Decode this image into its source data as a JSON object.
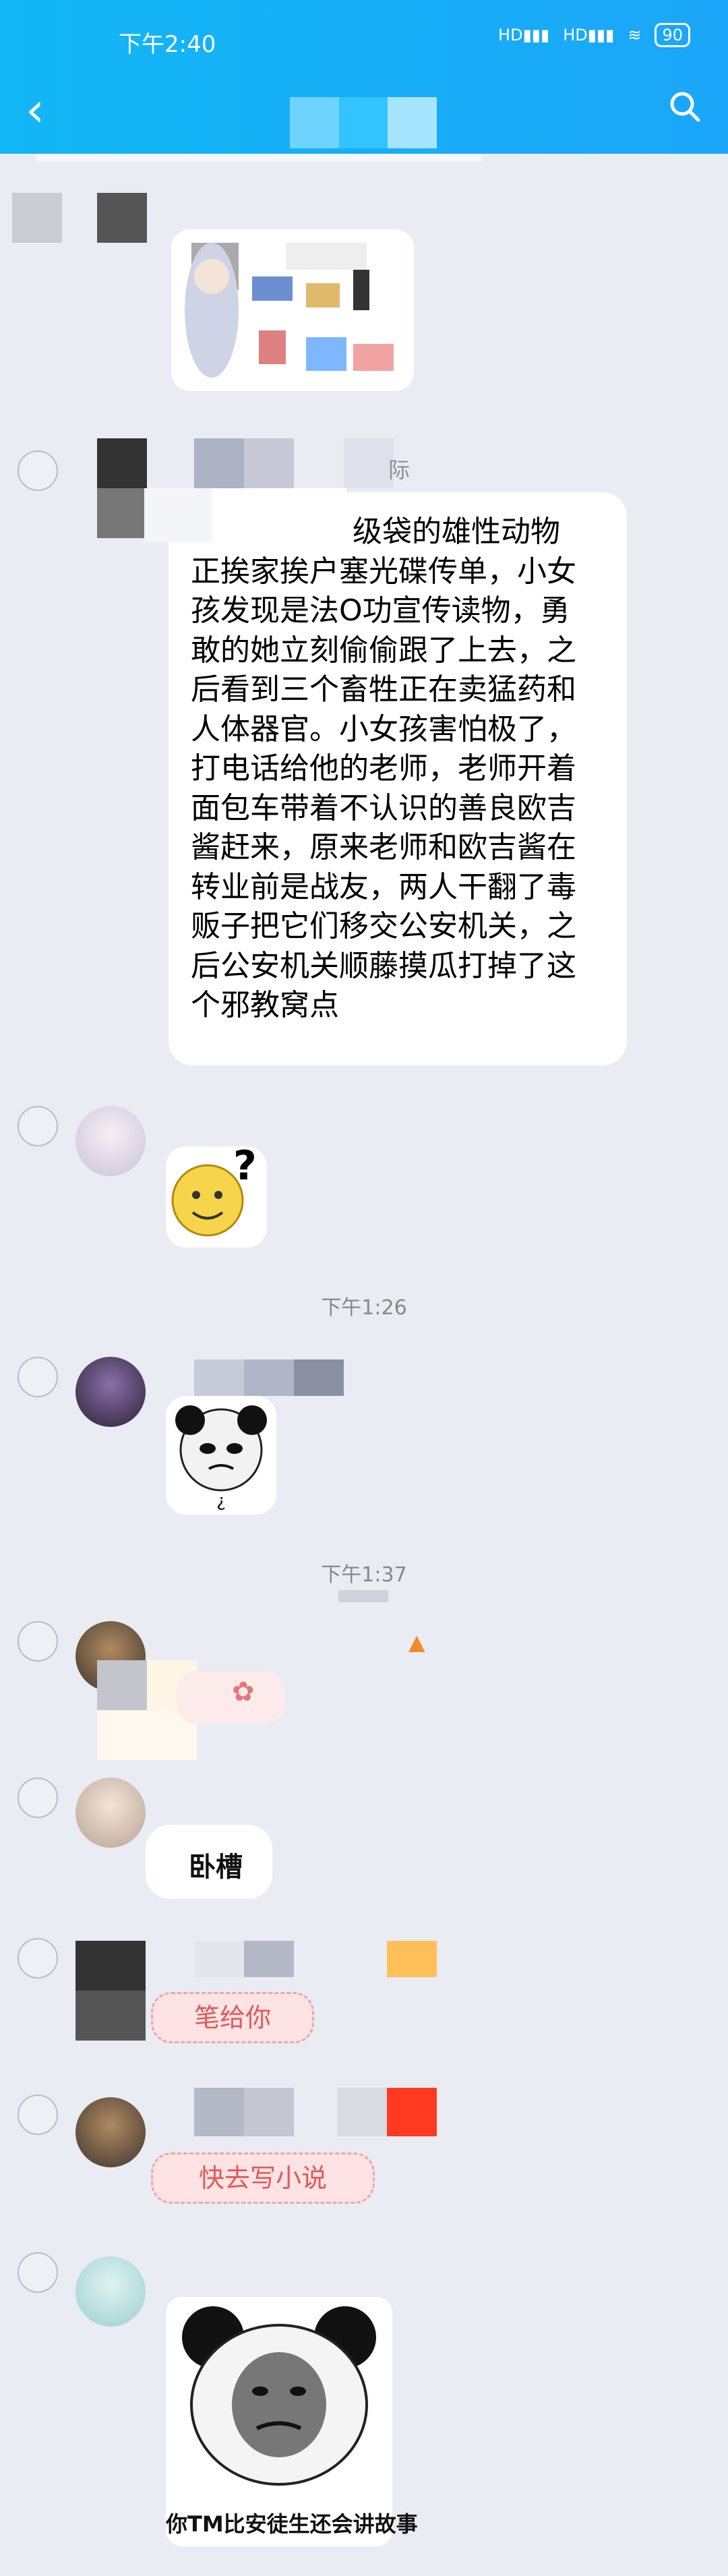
{
  "status": {
    "time": "下午2:40",
    "battery": "90",
    "hd1": "HD",
    "hd2": "HD"
  },
  "header": {
    "back_icon": "chevron-left-icon",
    "search_icon": "search-icon"
  },
  "messages": {
    "partial_name": "际",
    "long_message_lines": [
      "级袋的雄性动物",
      "正挨家挨户塞光碟传单，小女",
      "孩发现是法O功宣传读物，勇",
      "敢的她立刻偷偷跟了上去，之",
      "后看到三个畜牲正在卖猛药和",
      "人体器官。小女孩害怕极了，",
      "打电话给他的老师，老师开着",
      "面包车带着不认识的善良欧吉",
      "酱赶来，原来老师和欧吉酱在",
      "转业前是战友，两人干翻了毒",
      "贩子把它们移交公安机关，之",
      "后公安机关顺藤摸瓜打掉了这",
      "个邪教窝点"
    ],
    "timestamp_1": "下午1:26",
    "timestamp_2": "下午1:37",
    "text_woc": "卧槽",
    "tag_bigun": "笔给你",
    "tag_xiaoshuo": "快去写小说",
    "question_mark": "?",
    "panda_caption": "你TM比安徒生还会讲故事"
  }
}
